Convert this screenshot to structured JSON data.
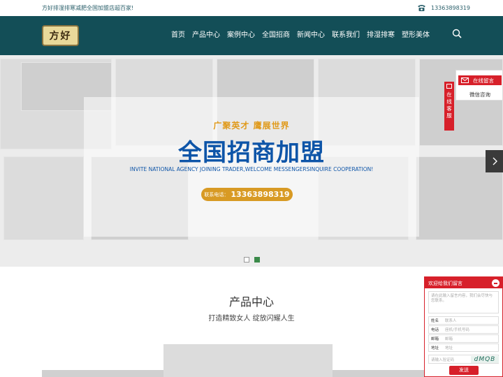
{
  "topbar": {
    "slogan": "方好排湿排寒减肥全国加盟店超百家!",
    "phone": "13363898319"
  },
  "header": {
    "logo_text": "方好",
    "nav": [
      {
        "label": "首页"
      },
      {
        "label": "产品中心"
      },
      {
        "label": "案例中心"
      },
      {
        "label": "全国招商"
      },
      {
        "label": "新闻中心"
      },
      {
        "label": "联系我们"
      },
      {
        "label": "排湿排寒"
      },
      {
        "label": "塑形美体"
      }
    ]
  },
  "banner": {
    "subtitle": "广聚英才  鹰展世界",
    "title": "全国招商加盟",
    "english": "INVITE NATIONAL AGENCY JOINING TRADER,WELCOME MESSENGERSINQUIRE COOPERATION!",
    "phone_label": "联系电话：",
    "phone": "13363898319",
    "slide_count": 2,
    "active_slide": 2
  },
  "products": {
    "title": "产品中心",
    "subtitle": "打造精致女人 绽放闪耀人生"
  },
  "side": {
    "message_label": "在线留言",
    "wechat_label": "微信咨询",
    "tab_label": "在线客服"
  },
  "chat": {
    "header": "欢迎给我们留言",
    "message_placeholder": "请在此输入留言内容，我们会尽快与您联系。",
    "fields": [
      {
        "label": "姓名",
        "placeholder": "联系人"
      },
      {
        "label": "电话",
        "placeholder": "座机/手机号码"
      },
      {
        "label": "邮箱",
        "placeholder": "邮箱"
      },
      {
        "label": "地址",
        "placeholder": "地址"
      }
    ],
    "captcha_placeholder": "请输入验证码",
    "captcha_text": "dMQB",
    "send_label": "发送"
  },
  "colors": {
    "header_bg": "#134e57",
    "accent_red": "#d7202a",
    "banner_blue": "#0e55a8",
    "banner_gold": "#d89a24"
  }
}
